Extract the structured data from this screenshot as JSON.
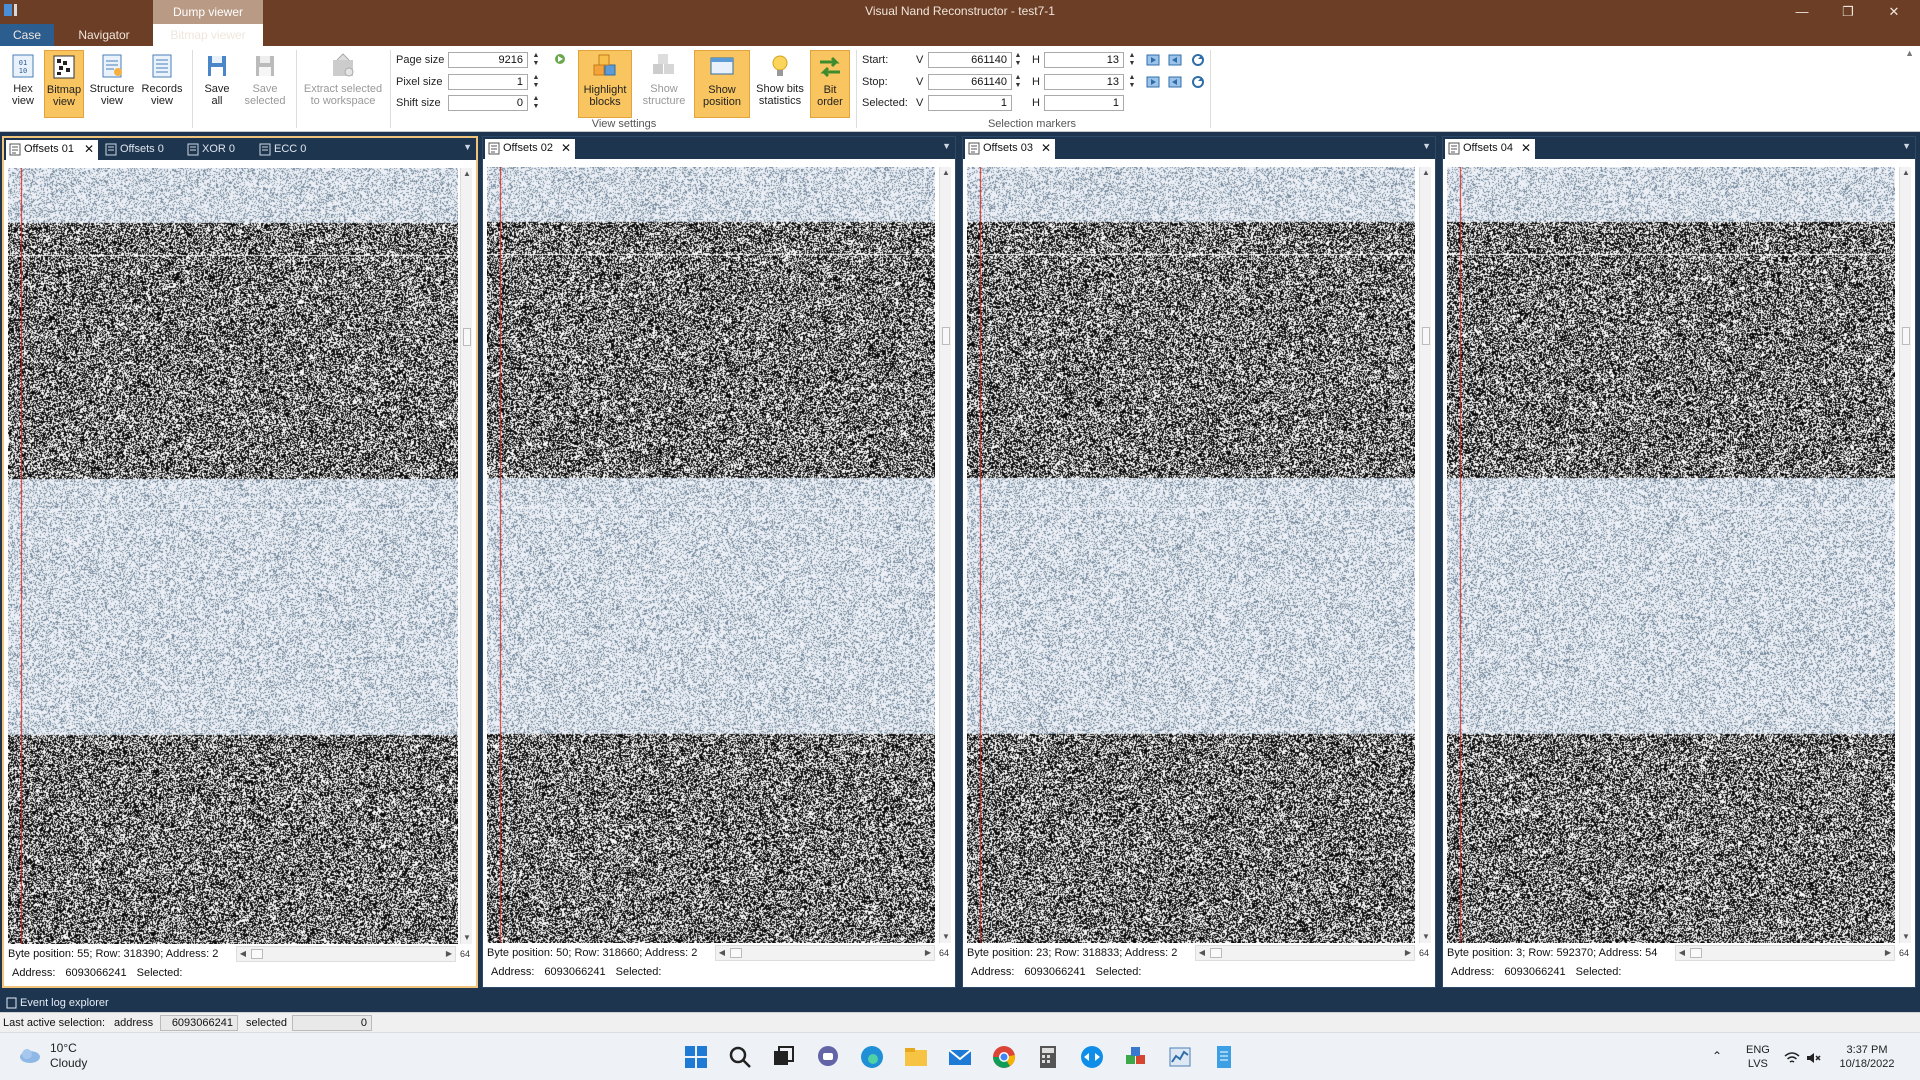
{
  "window": {
    "title": "Visual Nand Reconstructor - test7-1",
    "context_tab": "Dump viewer"
  },
  "ribbon_tabs": [
    {
      "label": "Case"
    },
    {
      "label": "Navigator"
    },
    {
      "label": "Bitmap viewer"
    }
  ],
  "ribbon": {
    "buttons": [
      {
        "label1": "Hex",
        "label2": "view",
        "icon": "hex-icon"
      },
      {
        "label1": "Bitmap",
        "label2": "view",
        "icon": "bitmap-icon"
      },
      {
        "label1": "Structure",
        "label2": "view",
        "icon": "structure-icon"
      },
      {
        "label1": "Records",
        "label2": "view",
        "icon": "records-icon"
      },
      {
        "label1": "Save",
        "label2": "all",
        "icon": "save-icon"
      },
      {
        "label1": "Save",
        "label2": "selected",
        "icon": "save-selected-icon"
      },
      {
        "label1": "Extract selected",
        "label2": "to workspace",
        "icon": "extract-icon"
      }
    ],
    "view_settings": {
      "page_size_label": "Page size",
      "page_size": "9216",
      "pixel_size_label": "Pixel size",
      "pixel_size": "1",
      "shift_size_label": "Shift size",
      "shift_size": "0",
      "group_label": "View settings",
      "buttons": [
        {
          "label1": "Highlight",
          "label2": "blocks"
        },
        {
          "label1": "Show",
          "label2": "structure"
        },
        {
          "label1": "Show",
          "label2": "position"
        },
        {
          "label1": "Show bits",
          "label2": "statistics"
        },
        {
          "label1": "Bit",
          "label2": "order"
        }
      ]
    },
    "selection_markers": {
      "start_label": "Start:",
      "stop_label": "Stop:",
      "selected_label": "Selected:",
      "v_label": "V",
      "h_label": "H",
      "start_v": "661140",
      "start_h": "13",
      "stop_v": "661140",
      "stop_h": "13",
      "selected_v": "1",
      "selected_h": "1",
      "group_label": "Selection markers"
    }
  },
  "panels": [
    {
      "tabs": [
        "Offsets 01",
        "Offsets 0",
        "XOR 0",
        "ECC 0"
      ],
      "status": "Byte position: 55; Row: 318390; Address: 2",
      "page": "64",
      "address_label": "Address:",
      "address": "6093066241",
      "selected_label": "Selected:"
    },
    {
      "tabs": [
        "Offsets 02"
      ],
      "status": "Byte position: 50; Row: 318660; Address: 2",
      "page": "64",
      "address_label": "Address:",
      "address": "6093066241",
      "selected_label": "Selected:"
    },
    {
      "tabs": [
        "Offsets 03"
      ],
      "status": "Byte position: 23; Row: 318833; Address: 2",
      "page": "64",
      "address_label": "Address:",
      "address": "6093066241",
      "selected_label": "Selected:"
    },
    {
      "tabs": [
        "Offsets 04"
      ],
      "status": "Byte position: 3; Row: 592370; Address: 54",
      "page": "64",
      "address_label": "Address:",
      "address": "6093066241",
      "selected_label": "Selected:"
    }
  ],
  "event_log": {
    "label": "Event log explorer"
  },
  "statusbar": {
    "label": "Last active selection:",
    "address_label": "address",
    "address": "6093066241",
    "selected_label": "selected",
    "selected": "0"
  },
  "taskbar": {
    "temp": "10°C",
    "condition": "Cloudy",
    "lang1": "ENG",
    "lang2": "LVS",
    "time": "3:37 PM",
    "date": "10/18/2022"
  },
  "colors": {
    "titlebar": "#6b3e25",
    "accent": "#f9c561",
    "panel_bg": "#1e3550"
  }
}
